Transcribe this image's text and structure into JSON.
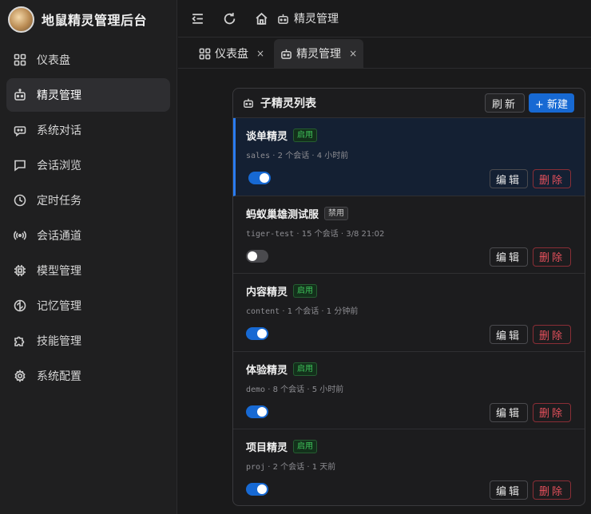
{
  "app": {
    "title": "地鼠精灵管理后台"
  },
  "sidebar": {
    "items": [
      {
        "label": "仪表盘",
        "icon": "dashboard-icon"
      },
      {
        "label": "精灵管理",
        "icon": "robot-icon",
        "active": true
      },
      {
        "label": "系统对话",
        "icon": "chat-bot-icon"
      },
      {
        "label": "会话浏览",
        "icon": "message-square-icon"
      },
      {
        "label": "定时任务",
        "icon": "clock-icon"
      },
      {
        "label": "会话通道",
        "icon": "broadcast-icon"
      },
      {
        "label": "模型管理",
        "icon": "chip-icon"
      },
      {
        "label": "记忆管理",
        "icon": "brain-icon"
      },
      {
        "label": "技能管理",
        "icon": "puzzle-icon"
      },
      {
        "label": "系统配置",
        "icon": "gear-icon"
      }
    ]
  },
  "topbar": {
    "breadcrumb": "精灵管理"
  },
  "tabs": [
    {
      "label": "仪表盘",
      "close": "×"
    },
    {
      "label": "精灵管理",
      "close": "×",
      "active": true
    }
  ],
  "panel": {
    "title": "子精灵列表",
    "refresh_label": "刷新",
    "new_label": "+ 新建",
    "edit_label": "编辑",
    "delete_label": "删除",
    "rows": [
      {
        "name": "谈单精灵",
        "status": "启用",
        "enabled": true,
        "id": "sales",
        "sessions": "2 个会话",
        "time": "4 小时前",
        "selected": true
      },
      {
        "name": "蚂蚁巢雄测试服",
        "status": "禁用",
        "enabled": false,
        "id": "tiger-test",
        "sessions": "15 个会话",
        "time": "3/8 21:02"
      },
      {
        "name": "内容精灵",
        "status": "启用",
        "enabled": true,
        "id": "content",
        "sessions": "1 个会话",
        "time": "1 分钟前"
      },
      {
        "name": "体验精灵",
        "status": "启用",
        "enabled": true,
        "id": "demo",
        "sessions": "8 个会话",
        "time": "5 小时前"
      },
      {
        "name": "项目精灵",
        "status": "启用",
        "enabled": true,
        "id": "proj",
        "sessions": "2 个会话",
        "time": "1 天前"
      }
    ]
  },
  "colors": {
    "accent": "#1769d3",
    "danger": "#e5505c",
    "enabled_badge": "#3fc25a"
  }
}
